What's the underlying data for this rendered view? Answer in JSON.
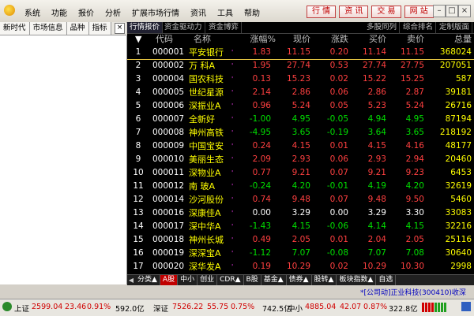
{
  "menu": [
    "系统",
    "功能",
    "报价",
    "分析",
    "扩展市场行情",
    "资讯",
    "工具",
    "帮助"
  ],
  "top_buttons": [
    "行 情",
    "资 讯",
    "交 易",
    "网 站"
  ],
  "left_tabs": [
    "新时代",
    "市场信息",
    "品种",
    "指标"
  ],
  "sub_tabs": [
    "行情报价",
    "资金驱动力",
    "资金博弈",
    "多股同列",
    "综合排名",
    "定制版面"
  ],
  "columns": [
    "代码",
    "名称",
    "涨幅%",
    "现价",
    "涨跌",
    "买价",
    "卖价",
    "总量"
  ],
  "rows": [
    {
      "idx": "1",
      "code": "000001",
      "name": "平安银行",
      "pct": "1.83",
      "price": "11.15",
      "chg": "0.20",
      "buy": "11.14",
      "sell": "11.15",
      "vol": "368024",
      "dir": "up"
    },
    {
      "idx": "2",
      "code": "000002",
      "name": "万 科A",
      "pct": "1.95",
      "price": "27.74",
      "chg": "0.53",
      "buy": "27.74",
      "sell": "27.75",
      "vol": "207051",
      "dir": "up"
    },
    {
      "idx": "3",
      "code": "000004",
      "name": "国农科技",
      "pct": "0.13",
      "price": "15.23",
      "chg": "0.02",
      "buy": "15.22",
      "sell": "15.25",
      "vol": "587",
      "dir": "up"
    },
    {
      "idx": "4",
      "code": "000005",
      "name": "世纪星源",
      "pct": "2.14",
      "price": "2.86",
      "chg": "0.06",
      "buy": "2.86",
      "sell": "2.87",
      "vol": "39181",
      "dir": "up"
    },
    {
      "idx": "5",
      "code": "000006",
      "name": "深振业A",
      "pct": "0.96",
      "price": "5.24",
      "chg": "0.05",
      "buy": "5.23",
      "sell": "5.24",
      "vol": "26716",
      "dir": "up"
    },
    {
      "idx": "6",
      "code": "000007",
      "name": "全新好",
      "pct": "-1.00",
      "price": "4.95",
      "chg": "-0.05",
      "buy": "4.94",
      "sell": "4.95",
      "vol": "87194",
      "dir": "dn"
    },
    {
      "idx": "7",
      "code": "000008",
      "name": "神州高铁",
      "pct": "-4.95",
      "price": "3.65",
      "chg": "-0.19",
      "buy": "3.64",
      "sell": "3.65",
      "vol": "218192",
      "dir": "dn"
    },
    {
      "idx": "8",
      "code": "000009",
      "name": "中国宝安",
      "pct": "0.24",
      "price": "4.15",
      "chg": "0.01",
      "buy": "4.15",
      "sell": "4.16",
      "vol": "48177",
      "dir": "up"
    },
    {
      "idx": "9",
      "code": "000010",
      "name": "美丽生态",
      "pct": "2.09",
      "price": "2.93",
      "chg": "0.06",
      "buy": "2.93",
      "sell": "2.94",
      "vol": "20460",
      "dir": "up"
    },
    {
      "idx": "10",
      "code": "000011",
      "name": "深物业A",
      "pct": "0.77",
      "price": "9.21",
      "chg": "0.07",
      "buy": "9.21",
      "sell": "9.23",
      "vol": "6453",
      "dir": "up"
    },
    {
      "idx": "11",
      "code": "000012",
      "name": "南 玻A",
      "pct": "-0.24",
      "price": "4.20",
      "chg": "-0.01",
      "buy": "4.19",
      "sell": "4.20",
      "vol": "32619",
      "dir": "dn"
    },
    {
      "idx": "12",
      "code": "000014",
      "name": "沙河股份",
      "pct": "0.74",
      "price": "9.48",
      "chg": "0.07",
      "buy": "9.48",
      "sell": "9.50",
      "vol": "5460",
      "dir": "up"
    },
    {
      "idx": "13",
      "code": "000016",
      "name": "深康佳A",
      "pct": "0.00",
      "price": "3.29",
      "chg": "0.00",
      "buy": "3.29",
      "sell": "3.30",
      "vol": "33083",
      "dir": "fl"
    },
    {
      "idx": "14",
      "code": "000017",
      "name": "深中华A",
      "pct": "-1.43",
      "price": "4.15",
      "chg": "-0.06",
      "buy": "4.14",
      "sell": "4.15",
      "vol": "32216",
      "dir": "dn"
    },
    {
      "idx": "15",
      "code": "000018",
      "name": "神州长城",
      "pct": "0.49",
      "price": "2.05",
      "chg": "0.01",
      "buy": "2.04",
      "sell": "2.05",
      "vol": "25116",
      "dir": "up"
    },
    {
      "idx": "16",
      "code": "000019",
      "name": "深深宝A",
      "pct": "-1.12",
      "price": "7.07",
      "chg": "-0.08",
      "buy": "7.07",
      "sell": "7.08",
      "vol": "30640",
      "dir": "dn"
    },
    {
      "idx": "17",
      "code": "000020",
      "name": "深华发A",
      "pct": "0.19",
      "price": "10.29",
      "chg": "0.02",
      "buy": "10.29",
      "sell": "10.30",
      "vol": "2998",
      "dir": "up"
    }
  ],
  "bottom_tabs": [
    "分类▲",
    "A股",
    "中小",
    "创业",
    "CDR▲",
    "B股",
    "基金▲",
    "债券▲",
    "股转▲",
    "板块指数▲",
    "自选"
  ],
  "ticker": "*[公司动]正业科技(300410)收深",
  "status": {
    "sh_name": "上证",
    "sh_index": "2599.04",
    "sh_chg": "23.46",
    "sh_pct": "0.91%",
    "sh_amt": "592.0亿",
    "sz_name": "深证",
    "sz_index": "7526.22",
    "sz_chg": "55.75",
    "sz_pct": "0.75%",
    "sz_amt": "742.5亿",
    "zx_name": "中小",
    "zx_index": "4885.04",
    "zx_chg": "42.07",
    "zx_pct": "0.87%",
    "zx_amt": "322.8亿"
  },
  "colors": {
    "up": "#ff4040",
    "down": "#00e000",
    "flat": "#ffffff",
    "name": "#ffff00",
    "accent": "#c00000"
  }
}
